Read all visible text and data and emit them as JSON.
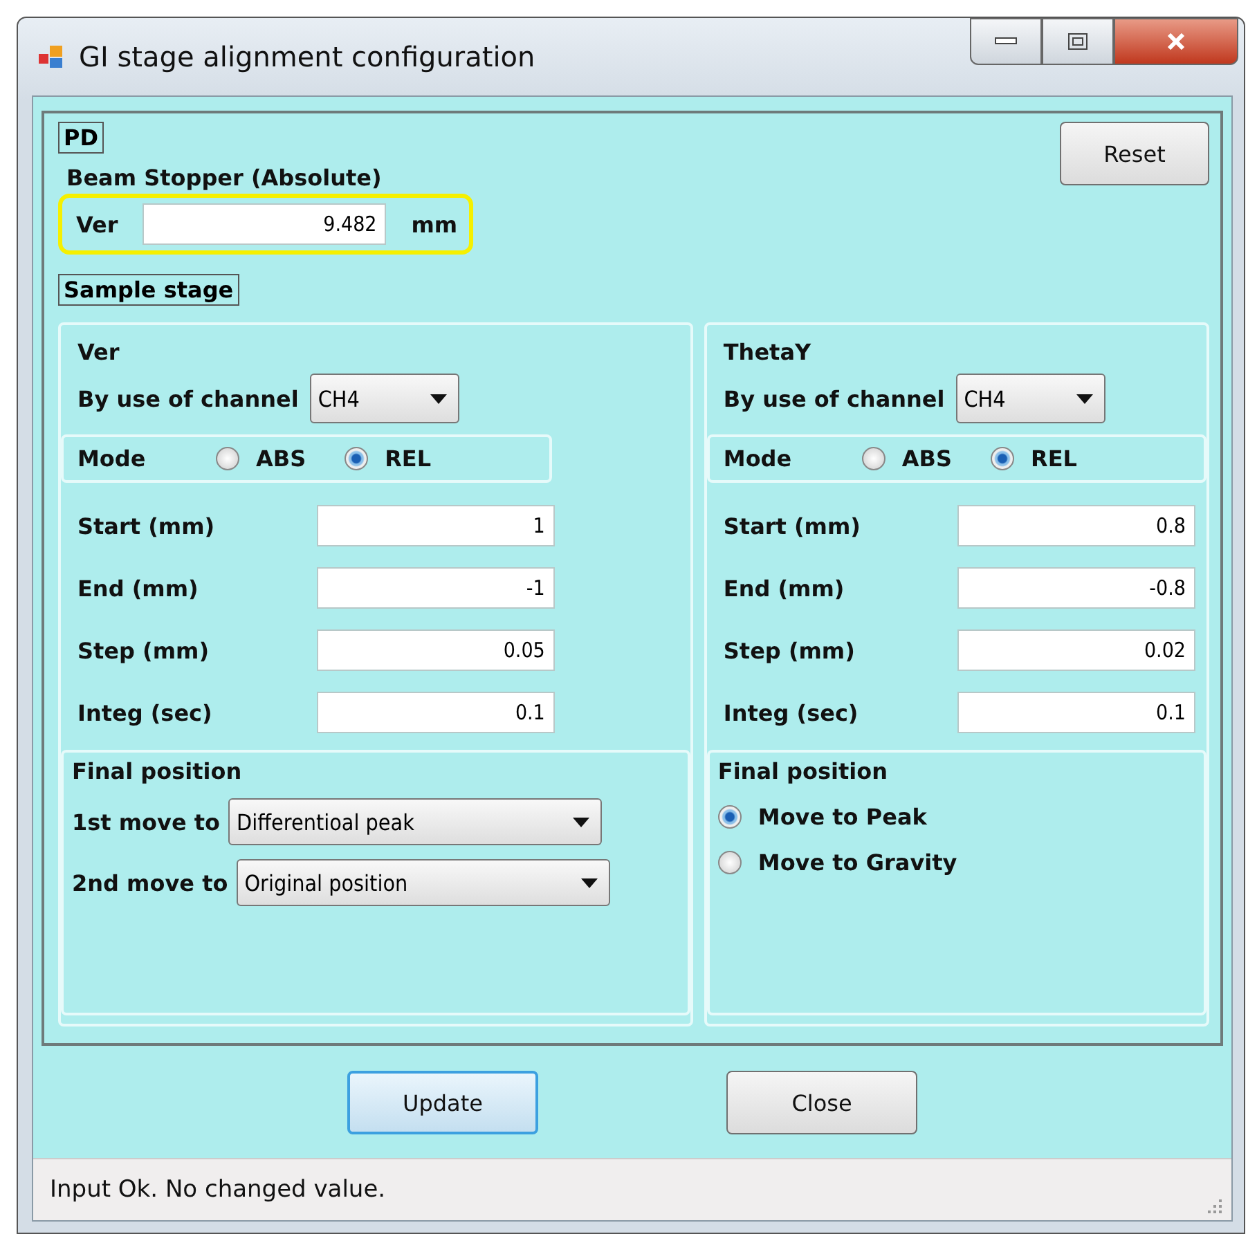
{
  "window": {
    "title": "GI stage alignment configuration"
  },
  "pd": {
    "label": "PD",
    "reset": "Reset",
    "heading": "Beam Stopper (Absolute)",
    "field_label": "Ver",
    "value": "9.482",
    "unit": "mm",
    "highlighted": true
  },
  "sample_stage": {
    "label": "Sample stage",
    "axes": [
      {
        "title": "Ver",
        "channel_label": "By use of channel",
        "channel": "CH4",
        "mode_label": "Mode",
        "modes": [
          {
            "label": "ABS",
            "selected": false
          },
          {
            "label": "REL",
            "selected": true
          }
        ],
        "params": [
          {
            "label": "Start (mm)",
            "value": "1"
          },
          {
            "label": "End (mm)",
            "value": "-1"
          },
          {
            "label": "Step (mm)",
            "value": "0.05"
          },
          {
            "label": "Integ (sec)",
            "value": "0.1"
          }
        ],
        "final": {
          "title": "Final position",
          "kind": "dropdowns",
          "moves": [
            {
              "label": "1st move to",
              "value": "Differentioal peak"
            },
            {
              "label": "2nd move to",
              "value": "Original position"
            }
          ]
        }
      },
      {
        "title": "ThetaY",
        "channel_label": "By use of channel",
        "channel": "CH4",
        "mode_label": "Mode",
        "modes": [
          {
            "label": "ABS",
            "selected": false
          },
          {
            "label": "REL",
            "selected": true
          }
        ],
        "params": [
          {
            "label": "Start (mm)",
            "value": "0.8"
          },
          {
            "label": "End (mm)",
            "value": "-0.8"
          },
          {
            "label": "Step (mm)",
            "value": "0.02"
          },
          {
            "label": "Integ (sec)",
            "value": "0.1"
          }
        ],
        "final": {
          "title": "Final position",
          "kind": "radios",
          "options": [
            {
              "label": "Move to Peak",
              "selected": true
            },
            {
              "label": "Move to Gravity",
              "selected": false
            }
          ]
        }
      }
    ]
  },
  "buttons": [
    {
      "label": "Update",
      "focused": true
    },
    {
      "label": "Close",
      "focused": false
    }
  ],
  "status_bar": "Input Ok. No changed value."
}
